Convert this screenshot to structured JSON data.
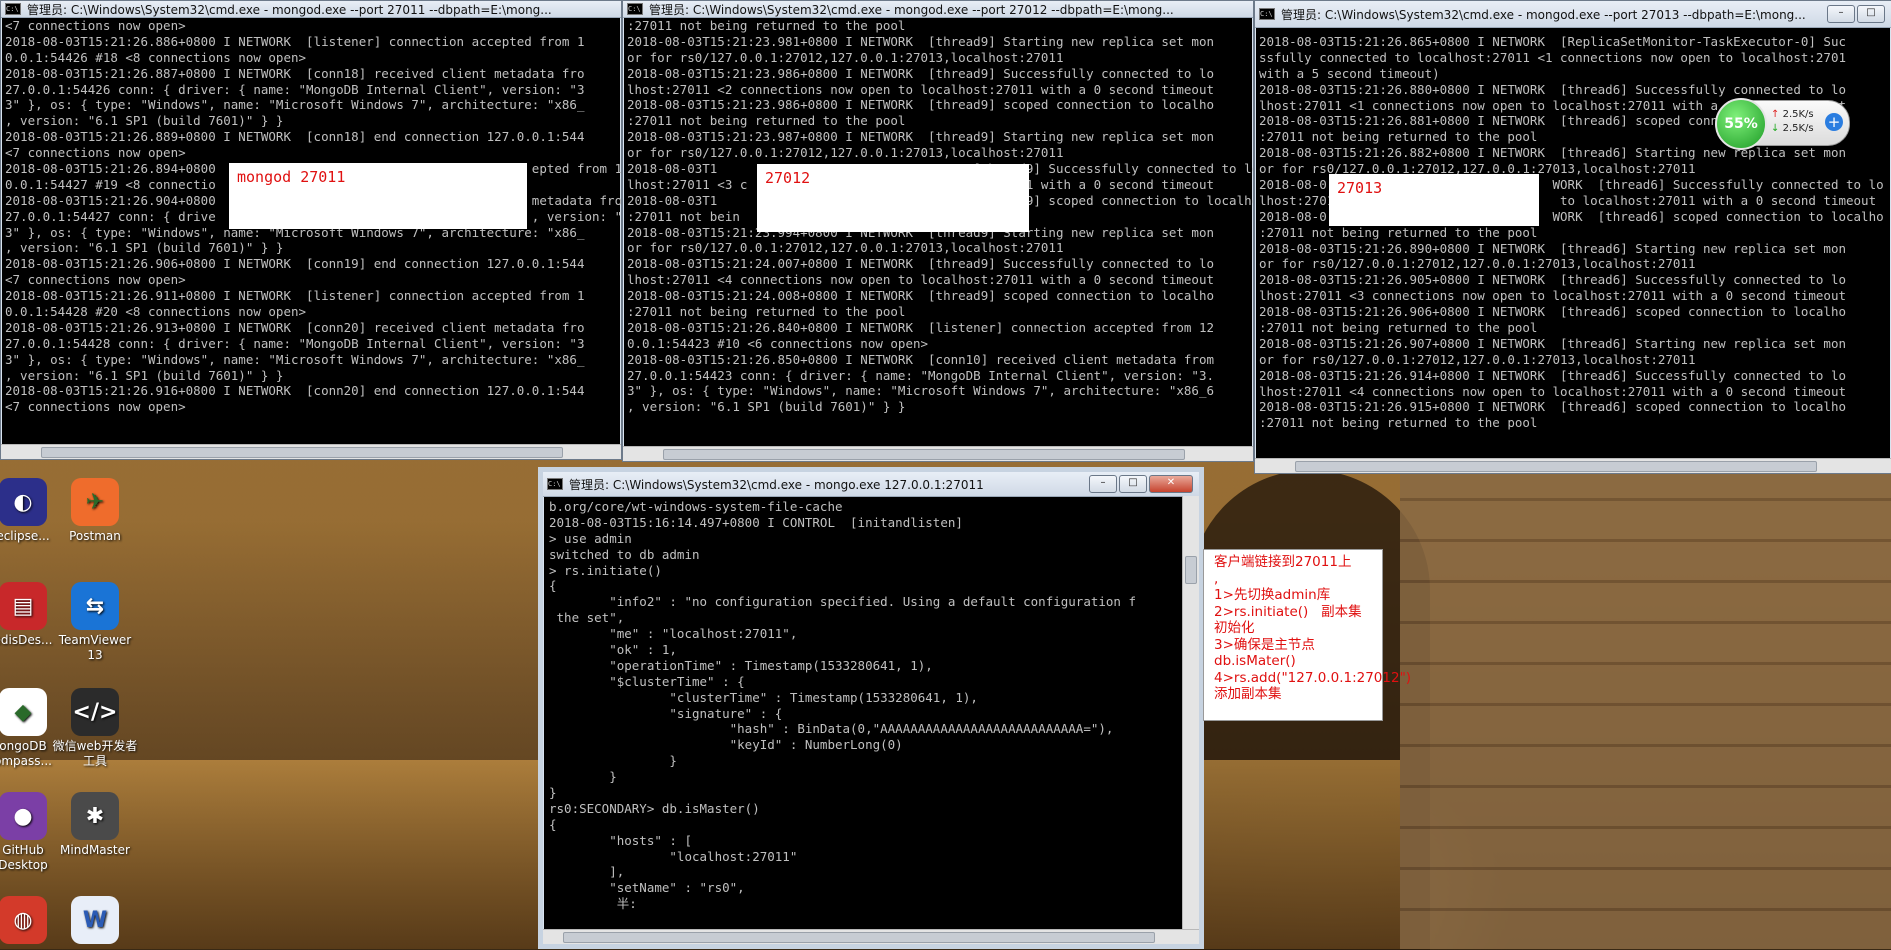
{
  "windows": {
    "w1": {
      "title": "管理员: C:\\Windows\\System32\\cmd.exe - mongod.exe  --port 27011 --dbpath=E:\\mong...",
      "label": "mongod 27011",
      "lines": [
        "<7 connections now open>",
        "2018-08-03T15:21:26.886+0800 I NETWORK  [listener] connection accepted from 1",
        "0.0.1:54426 #18 <8 connections now open>",
        "2018-08-03T15:21:26.887+0800 I NETWORK  [conn18] received client metadata fro",
        "27.0.0.1:54426 conn: { driver: { name: \"MongoDB Internal Client\", version: \"3",
        "3\" }, os: { type: \"Windows\", name: \"Microsoft Windows 7\", architecture: \"x86_",
        ", version: \"6.1 SP1 (build 7601)\" } }",
        "2018-08-03T15:21:26.889+0800 I NETWORK  [conn18] end connection 127.0.0.1:544",
        "<7 connections now open>",
        "2018-08-03T15:21:26.894+0800                                          epted from 1",
        "0.0.1:54427 #19 <8 connectio",
        "2018-08-03T15:21:26.904+0800                                          metadata fro",
        "27.0.0.1:54427 conn: { drive                                          , version: \"3",
        "3\" }, os: { type: \"Windows\", name: \"Microsoft Windows 7\", architecture: \"x86_",
        ", version: \"6.1 SP1 (build 7601)\" } }",
        "2018-08-03T15:21:26.906+0800 I NETWORK  [conn19] end connection 127.0.0.1:544",
        "<7 connections now open>",
        "2018-08-03T15:21:26.911+0800 I NETWORK  [listener] connection accepted from 1",
        "0.0.1:54428 #20 <8 connections now open>",
        "2018-08-03T15:21:26.913+0800 I NETWORK  [conn20] received client metadata fro",
        "27.0.0.1:54428 conn: { driver: { name: \"MongoDB Internal Client\", version: \"3",
        "3\" }, os: { type: \"Windows\", name: \"Microsoft Windows 7\", architecture: \"x86_",
        ", version: \"6.1 SP1 (build 7601)\" } }",
        "2018-08-03T15:21:26.916+0800 I NETWORK  [conn20] end connection 127.0.0.1:544",
        "<7 connections now open>"
      ]
    },
    "w2": {
      "title": "管理员: C:\\Windows\\System32\\cmd.exe - mongod.exe  --port 27012 --dbpath=E:\\mong...",
      "label": "27012",
      "lines": [
        ":27011 not being returned to the pool",
        "2018-08-03T15:21:23.981+0800 I NETWORK  [thread9] Starting new replica set mon",
        "or for rs0/127.0.0.1:27012,127.0.0.1:27013,localhost:27011",
        "2018-08-03T15:21:23.986+0800 I NETWORK  [thread9] Successfully connected to lo",
        "lhost:27011 <2 connections now open to localhost:27011 with a 0 second timeout",
        "2018-08-03T15:21:23.986+0800 I NETWORK  [thread9] scoped connection to localho",
        ":27011 not being returned to the pool",
        "2018-08-03T15:21:23.987+0800 I NETWORK  [thread9] Starting new replica set mon",
        "or for rs0/127.0.0.1:27012,127.0.0.1:27013,localhost:27011",
        "2018-08-03T1                                  [thread9] Successfully connected to lo",
        "lhost:27011 <3 c                                  7011 with a 0 second timeout",
        "2018-08-03T1                                  [thread9] scoped connection to localho",
        ":27011 not bein",
        "2018-08-03T15:21:23.994+0800 I NETWORK  [thread9] Starting new replica set mon",
        "or for rs0/127.0.0.1:27012,127.0.0.1:27013,localhost:27011",
        "2018-08-03T15:21:24.007+0800 I NETWORK  [thread9] Successfully connected to lo",
        "lhost:27011 <4 connections now open to localhost:27011 with a 0 second timeout",
        "2018-08-03T15:21:24.008+0800 I NETWORK  [thread9] scoped connection to localho",
        ":27011 not being returned to the pool",
        "2018-08-03T15:21:26.840+0800 I NETWORK  [listener] connection accepted from 12",
        "0.0.1:54423 #10 <6 connections now open>",
        "2018-08-03T15:21:26.850+0800 I NETWORK  [conn10] received client metadata from",
        "27.0.0.1:54423 conn: { driver: { name: \"MongoDB Internal Client\", version: \"3.",
        "3\" }, os: { type: \"Windows\", name: \"Microsoft Windows 7\", architecture: \"x86_6",
        ", version: \"6.1 SP1 (build 7601)\" } }"
      ]
    },
    "w3": {
      "title": "管理员: C:\\Windows\\System32\\cmd.exe - mongod.exe  --port 27013 --dbpath=E:\\mong...",
      "label": "27013",
      "lines": [
        "2018-08-03T15:21:26.865+0800 I NETWORK  [ReplicaSetMonitor-TaskExecutor-0] Suc",
        "ssfully connected to localhost:27011 <1 connections now open to localhost:2701",
        "with a 5 second timeout)",
        "2018-08-03T15:21:26.880+0800 I NETWORK  [thread6] Successfully connected to lo",
        "lhost:27011 <1 connections now open to localhost:27011 with a 0 second timeout",
        "2018-08-03T15:21:26.881+0800 I NETWORK  [thread6] scoped connection to localho",
        ":27011 not being returned to the pool",
        "2018-08-03T15:21:26.882+0800 I NETWORK  [thread6] Starting new replica set mon",
        "or for rs0/127.0.0.1:27012,127.0.0.1:27013,localhost:27011",
        "2018-08-0                              WORK  [thread6] Successfully connected to lo",
        "lhost:2701                              to localhost:27011 with a 0 second timeout",
        "2018-08-0                              WORK  [thread6] scoped connection to localho",
        ":27011 not being returned to the pool",
        "2018-08-03T15:21:26.890+0800 I NETWORK  [thread6] Starting new replica set mon",
        "or for rs0/127.0.0.1:27012,127.0.0.1:27013,localhost:27011",
        "2018-08-03T15:21:26.905+0800 I NETWORK  [thread6] Successfully connected to lo",
        "lhost:27011 <3 connections now open to localhost:27011 with a 0 second timeout",
        "2018-08-03T15:21:26.906+0800 I NETWORK  [thread6] scoped connection to localho",
        ":27011 not being returned to the pool",
        "2018-08-03T15:21:26.907+0800 I NETWORK  [thread6] Starting new replica set mon",
        "or for rs0/127.0.0.1:27012,127.0.0.1:27013,localhost:27011",
        "2018-08-03T15:21:26.914+0800 I NETWORK  [thread6] Successfully connected to lo",
        "lhost:27011 <4 connections now open to localhost:27011 with a 0 second timeout",
        "2018-08-03T15:21:26.915+0800 I NETWORK  [thread6] scoped connection to localho",
        ":27011 not being returned to the pool"
      ]
    },
    "w4": {
      "title": "管理员: C:\\Windows\\System32\\cmd.exe - mongo.exe  127.0.0.1:27011",
      "lines": [
        "b.org/core/wt-windows-system-file-cache",
        "2018-08-03T15:16:14.497+0800 I CONTROL  [initandlisten]",
        "> use admin",
        "switched to db admin",
        "> rs.initiate()",
        "{",
        "        \"info2\" : \"no configuration specified. Using a default configuration f",
        " the set\",",
        "        \"me\" : \"localhost:27011\",",
        "        \"ok\" : 1,",
        "        \"operationTime\" : Timestamp(1533280641, 1),",
        "        \"$clusterTime\" : {",
        "                \"clusterTime\" : Timestamp(1533280641, 1),",
        "                \"signature\" : {",
        "                        \"hash\" : BinData(0,\"AAAAAAAAAAAAAAAAAAAAAAAAAAA=\"),",
        "                        \"keyId\" : NumberLong(0)",
        "                }",
        "        }",
        "}",
        "rs0:SECONDARY> db.isMaster()",
        "{",
        "        \"hosts\" : [",
        "                \"localhost:27011\"",
        "        ],",
        "        \"setName\" : \"rs0\",",
        "         半:"
      ]
    }
  },
  "note": {
    "lines": [
      "客户端链接到27011上",
      ",",
      "1>先切换admin库",
      "2>rs.initiate()   副本集初始化",
      "3>确保是主节点",
      "db.isMater()",
      "4>rs.add(\"127.0.0.1:27012\") 添加副本集"
    ]
  },
  "network": {
    "percent": "55%",
    "up": "2.5K/s",
    "down": "2.5K/s"
  },
  "desktop_icons": [
    {
      "name": "eclipse",
      "label": "eclipse...",
      "glyph": "◐",
      "color": "#2c2f8a"
    },
    {
      "name": "postman",
      "label": "Postman",
      "glyph": "✈",
      "color": "#ef6c2c"
    },
    {
      "name": "redisdesktop",
      "label": "edisDes...",
      "glyph": "▤",
      "color": "#c8282a"
    },
    {
      "name": "teamviewer",
      "label": "TeamViewer 13",
      "glyph": "⇆",
      "color": "#1a74d6"
    },
    {
      "name": "mongodb-compass",
      "label": "ongoDB ompass...",
      "glyph": "◆",
      "color": "#ffffff"
    },
    {
      "name": "weixin-devtools",
      "label": "微信web开发者工具",
      "glyph": "</>",
      "color": "#2b2b2b"
    },
    {
      "name": "github-desktop",
      "label": "GitHub Desktop",
      "glyph": "●",
      "color": "#7b3fa6"
    },
    {
      "name": "mindmaster",
      "label": "MindMaster",
      "glyph": "✱",
      "color": "#4a4a4a"
    },
    {
      "name": "app-swirl",
      "label": "",
      "glyph": "◍",
      "color": "#d33a2a"
    },
    {
      "name": "word-doc",
      "label": "",
      "glyph": "W",
      "color": "#e8eef8"
    }
  ]
}
